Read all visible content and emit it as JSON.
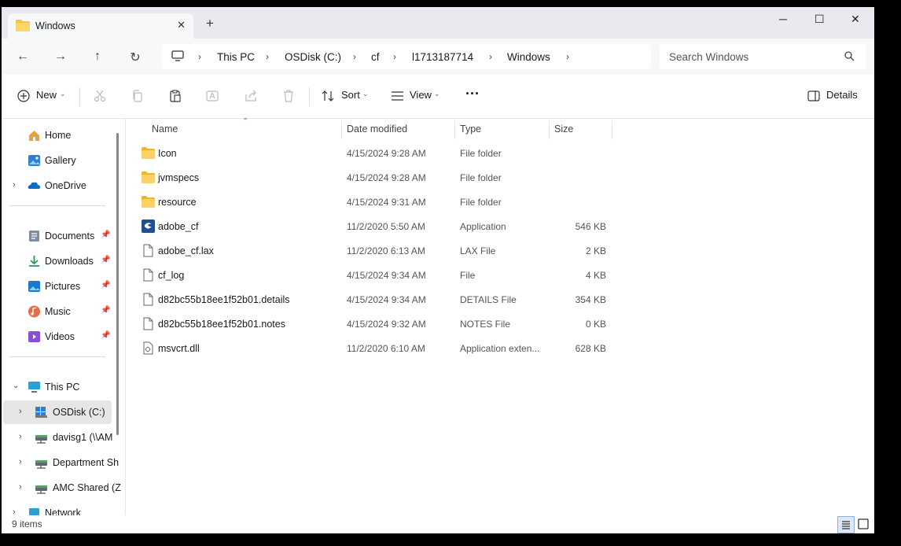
{
  "tab": {
    "title": "Windows",
    "close": "✕",
    "new_tab": "+"
  },
  "window_controls": {
    "minimize": "─",
    "maximize": "☐",
    "close": "✕"
  },
  "nav": {
    "back": "←",
    "forward": "→",
    "up": "↑",
    "refresh": "↻"
  },
  "breadcrumb": [
    "This PC",
    "OSDisk (C:)",
    "cf",
    "l1713187714",
    "Windows"
  ],
  "breadcrumb_sep": "›",
  "search": {
    "placeholder": "Search Windows"
  },
  "toolbar": {
    "new": "New",
    "sort": "Sort",
    "view": "View",
    "more": "···",
    "details": "Details"
  },
  "sidebar": {
    "quick": [
      {
        "label": "Home",
        "icon": "home-icon"
      },
      {
        "label": "Gallery",
        "icon": "gallery-icon"
      },
      {
        "label": "OneDrive",
        "icon": "onedrive-icon",
        "expandable": true
      }
    ],
    "pinned": [
      {
        "label": "Documents",
        "icon": "documents-icon"
      },
      {
        "label": "Downloads",
        "icon": "downloads-icon"
      },
      {
        "label": "Pictures",
        "icon": "pictures-icon"
      },
      {
        "label": "Music",
        "icon": "music-icon"
      },
      {
        "label": "Videos",
        "icon": "videos-icon"
      }
    ],
    "drives": [
      {
        "label": "This PC",
        "icon": "pc-icon",
        "expanded": true
      },
      {
        "label": "OSDisk (C:)",
        "icon": "osdisk-icon",
        "selected": true
      },
      {
        "label": "davisg1 (\\\\AM",
        "icon": "network-drive-icon"
      },
      {
        "label": "Department Sh",
        "icon": "network-drive-icon"
      },
      {
        "label": "AMC Shared (Z",
        "icon": "network-drive-icon"
      },
      {
        "label": "Network",
        "icon": "network-icon"
      }
    ]
  },
  "columns": {
    "name": "Name",
    "date": "Date modified",
    "type": "Type",
    "size": "Size"
  },
  "files": [
    {
      "name": "Icon",
      "date": "4/15/2024 9:28 AM",
      "type": "File folder",
      "size": "",
      "kind": "folder"
    },
    {
      "name": "jvmspecs",
      "date": "4/15/2024 9:28 AM",
      "type": "File folder",
      "size": "",
      "kind": "folder"
    },
    {
      "name": "resource",
      "date": "4/15/2024 9:31 AM",
      "type": "File folder",
      "size": "",
      "kind": "folder"
    },
    {
      "name": "adobe_cf",
      "date": "11/2/2020 5:50 AM",
      "type": "Application",
      "size": "546 KB",
      "kind": "app"
    },
    {
      "name": "adobe_cf.lax",
      "date": "11/2/2020 6:13 AM",
      "type": "LAX File",
      "size": "2 KB",
      "kind": "file"
    },
    {
      "name": "cf_log",
      "date": "4/15/2024 9:34 AM",
      "type": "File",
      "size": "4 KB",
      "kind": "file"
    },
    {
      "name": "d82bc55b18ee1f52b01.details",
      "date": "4/15/2024 9:34 AM",
      "type": "DETAILS File",
      "size": "354 KB",
      "kind": "file"
    },
    {
      "name": "d82bc55b18ee1f52b01.notes",
      "date": "4/15/2024 9:32 AM",
      "type": "NOTES File",
      "size": "0 KB",
      "kind": "file"
    },
    {
      "name": "msvcrt.dll",
      "date": "11/2/2020 6:10 AM",
      "type": "Application exten...",
      "size": "628 KB",
      "kind": "dll"
    }
  ],
  "status": {
    "count": "9 items"
  }
}
